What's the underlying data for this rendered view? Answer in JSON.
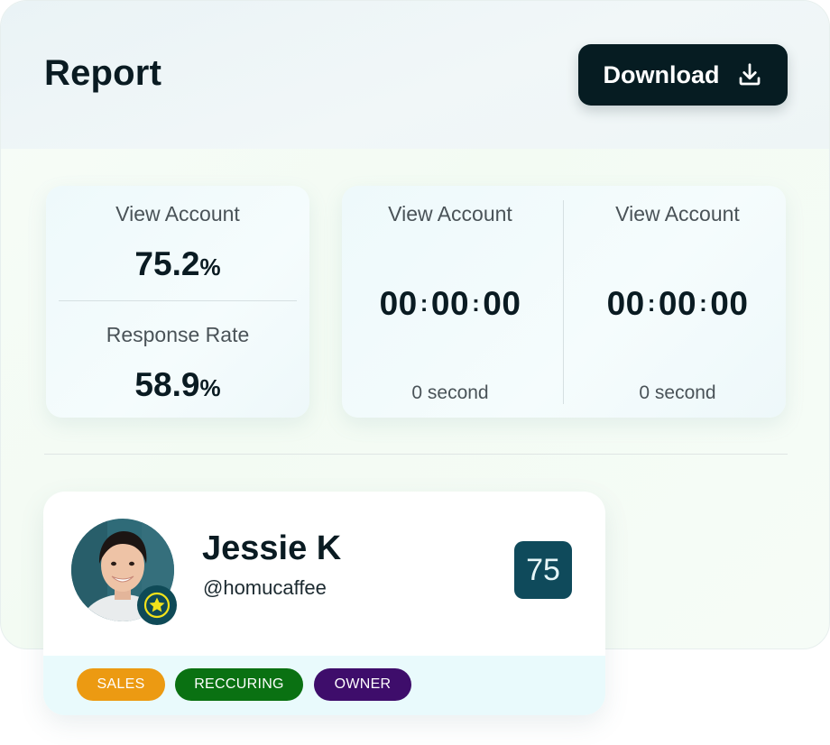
{
  "header": {
    "title": "Report",
    "download_label": "Download"
  },
  "stats_left": {
    "metric1": {
      "label": "View Account",
      "value": "75.2",
      "unit": "%"
    },
    "metric2": {
      "label": "Response Rate",
      "value": "58.9",
      "unit": "%"
    }
  },
  "timers": [
    {
      "label": "View Account",
      "hours": "00",
      "minutes": "00",
      "seconds": "00",
      "separator": ":",
      "sub": "0 second"
    },
    {
      "label": "View Account",
      "hours": "00",
      "minutes": "00",
      "seconds": "00",
      "separator": ":",
      "sub": "0 second"
    }
  ],
  "profile": {
    "name": "Jessie K",
    "handle": "@homucaffee",
    "score": "75",
    "tags": [
      {
        "label": "SALES",
        "color": "#ec9a12"
      },
      {
        "label": "RECCURING",
        "color": "#0a7112"
      },
      {
        "label": "OWNER",
        "color": "#3e0d6b"
      }
    ]
  },
  "icons": {
    "download": "download-icon",
    "badge": "star-badge-icon"
  },
  "colors": {
    "primary_dark": "#061c22",
    "score_bg": "#0f4a5b",
    "star": "#f2e21a"
  }
}
